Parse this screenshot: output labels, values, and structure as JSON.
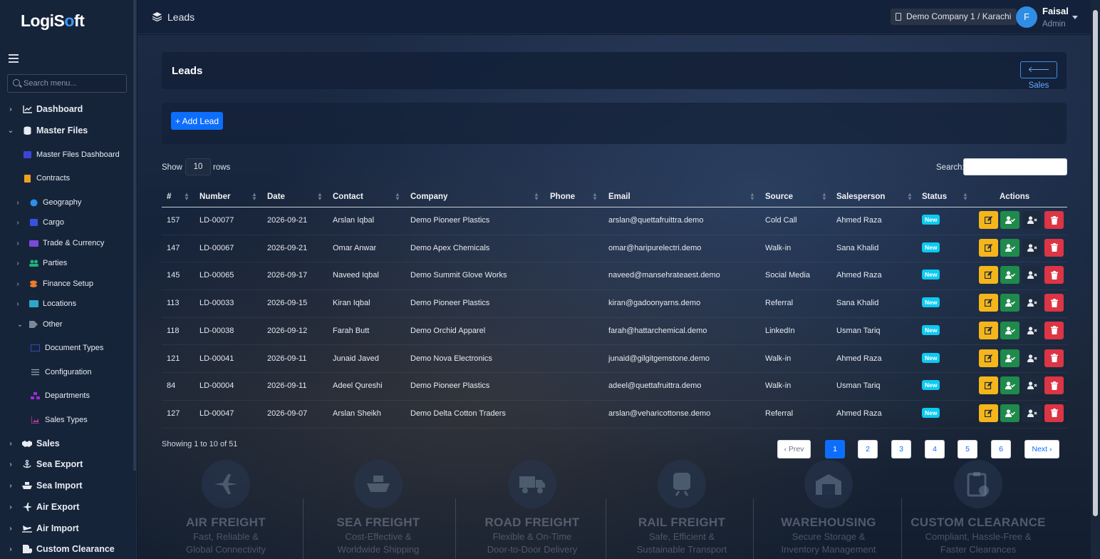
{
  "app": {
    "logo_prefix": "LogiS",
    "logo_o": "o",
    "logo_suffix": "ft"
  },
  "sidebar": {
    "search_placeholder": "Search menu...",
    "items": [
      {
        "label": "Dashboard",
        "icon": "chart-line-icon"
      },
      {
        "label": "Master Files",
        "icon": "database-icon"
      },
      {
        "label": "Master Files Dashboard",
        "icon": "dashboard-icon"
      },
      {
        "label": "Contracts",
        "icon": "file-contract-icon"
      },
      {
        "label": "Geography",
        "icon": "globe-icon"
      },
      {
        "label": "Cargo",
        "icon": "box-icon"
      },
      {
        "label": "Trade & Currency",
        "icon": "money-icon"
      },
      {
        "label": "Parties",
        "icon": "users-icon"
      },
      {
        "label": "Finance Setup",
        "icon": "coins-icon"
      },
      {
        "label": "Locations",
        "icon": "warehouse-icon"
      },
      {
        "label": "Other",
        "icon": "tags-icon"
      },
      {
        "label": "Document Types",
        "icon": "id-card-icon"
      },
      {
        "label": "Configuration",
        "icon": "sliders-icon"
      },
      {
        "label": "Departments",
        "icon": "sitemap-icon"
      },
      {
        "label": "Sales Types",
        "icon": "chart-area-icon"
      },
      {
        "label": "Sales",
        "icon": "handshake-icon"
      },
      {
        "label": "Sea Export",
        "icon": "anchor-icon"
      },
      {
        "label": "Sea Import",
        "icon": "ship-icon"
      },
      {
        "label": "Air Export",
        "icon": "plane-icon"
      },
      {
        "label": "Air Import",
        "icon": "plane-arrival-icon"
      },
      {
        "label": "Custom Clearance",
        "icon": "file-shield-icon"
      }
    ]
  },
  "topbar": {
    "title": "Leads",
    "company": "Demo Company 1 / Karachi",
    "user_initial": "F",
    "user_name": "Faisal",
    "user_role": "Admin"
  },
  "page": {
    "title": "Leads",
    "back_label": "Sales",
    "add_label": "+ Add Lead",
    "show_label": "Show",
    "rows_value": "10",
    "rows_label": "rows",
    "search_label": "Search:",
    "search_value": ""
  },
  "table": {
    "headers": [
      "#",
      "Number",
      "Date",
      "Contact",
      "Company",
      "Phone",
      "Email",
      "Source",
      "Salesperson",
      "Status",
      "Actions"
    ],
    "rows": [
      {
        "id": "157",
        "number": "LD-00077",
        "date": "2026-09-21",
        "contact": "Arslan Iqbal",
        "company": "Demo Pioneer Plastics",
        "phone": "",
        "email": "arslan@quettafruittra.demo",
        "source": "Cold Call",
        "salesperson": "Ahmed Raza",
        "status": "New"
      },
      {
        "id": "147",
        "number": "LD-00067",
        "date": "2026-09-21",
        "contact": "Omar Anwar",
        "company": "Demo Apex Chemicals",
        "phone": "",
        "email": "omar@haripurelectri.demo",
        "source": "Walk-in",
        "salesperson": "Sana Khalid",
        "status": "New"
      },
      {
        "id": "145",
        "number": "LD-00065",
        "date": "2026-09-17",
        "contact": "Naveed Iqbal",
        "company": "Demo Summit Glove Works",
        "phone": "",
        "email": "naveed@mansehrateaest.demo",
        "source": "Social Media",
        "salesperson": "Ahmed Raza",
        "status": "New"
      },
      {
        "id": "113",
        "number": "LD-00033",
        "date": "2026-09-15",
        "contact": "Kiran Iqbal",
        "company": "Demo Pioneer Plastics",
        "phone": "",
        "email": "kiran@gadoonyarns.demo",
        "source": "Referral",
        "salesperson": "Sana Khalid",
        "status": "New"
      },
      {
        "id": "118",
        "number": "LD-00038",
        "date": "2026-09-12",
        "contact": "Farah Butt",
        "company": "Demo Orchid Apparel",
        "phone": "",
        "email": "farah@hattarchemical.demo",
        "source": "LinkedIn",
        "salesperson": "Usman Tariq",
        "status": "New"
      },
      {
        "id": "121",
        "number": "LD-00041",
        "date": "2026-09-11",
        "contact": "Junaid Javed",
        "company": "Demo Nova Electronics",
        "phone": "",
        "email": "junaid@gilgitgemstone.demo",
        "source": "Walk-in",
        "salesperson": "Ahmed Raza",
        "status": "New"
      },
      {
        "id": "84",
        "number": "LD-00004",
        "date": "2026-09-11",
        "contact": "Adeel Qureshi",
        "company": "Demo Pioneer Plastics",
        "phone": "",
        "email": "adeel@quettafruittra.demo",
        "source": "Walk-in",
        "salesperson": "Usman Tariq",
        "status": "New"
      },
      {
        "id": "127",
        "number": "LD-00047",
        "date": "2026-09-07",
        "contact": "Arslan Sheikh",
        "company": "Demo Delta Cotton Traders",
        "phone": "",
        "email": "arslan@veharicottonse.demo",
        "source": "Referral",
        "salesperson": "Ahmed Raza",
        "status": "New"
      }
    ]
  },
  "footer": {
    "info": "Showing 1 to 10 of 51",
    "prev": "‹ Prev",
    "pages": [
      "1",
      "2",
      "3",
      "4",
      "5",
      "6"
    ],
    "active_page": "1",
    "next": "Next ›"
  },
  "banner": [
    {
      "title": "AIR FREIGHT",
      "line1": "Fast, Reliable &",
      "line2": "Global Connectivity",
      "icon": "plane-icon"
    },
    {
      "title": "SEA FREIGHT",
      "line1": "Cost-Effective &",
      "line2": "Worldwide Shipping",
      "icon": "ship-icon"
    },
    {
      "title": "ROAD FREIGHT",
      "line1": "Flexible & On-Time",
      "line2": "Door-to-Door Delivery",
      "icon": "truck-icon"
    },
    {
      "title": "RAIL FREIGHT",
      "line1": "Safe, Efficient &",
      "line2": "Sustainable Transport",
      "icon": "train-icon"
    },
    {
      "title": "WAREHOUSING",
      "line1": "Secure Storage &",
      "line2": "Inventory Management",
      "icon": "warehouse-icon"
    },
    {
      "title": "CUSTOM CLEARANCE",
      "line1": "Compliant, Hassle-Free &",
      "line2": "Faster Clearances",
      "icon": "clipboard-check-icon"
    }
  ],
  "colors": {
    "primary": "#0d6efd",
    "badge": "#0dcaf0",
    "edit": "#f4b61a",
    "convert": "#1f8a4c",
    "delete": "#dc3545"
  }
}
